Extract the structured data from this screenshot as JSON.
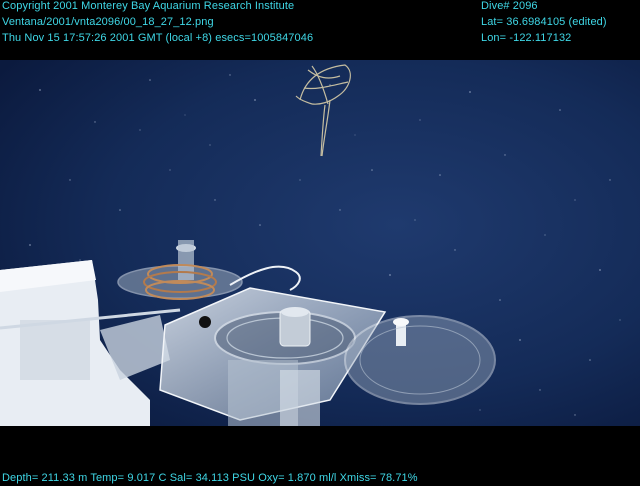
{
  "header": {
    "left_lines": [
      "Copyright 2001 Monterey Bay Aquarium Research Institute",
      "Ventana/2001/vnta2096/00_18_27_12.png",
      "Thu Nov 15 17:57:26 2001 GMT (local +8)  esecs=1005847046"
    ],
    "right_lines": [
      "Dive# 2096",
      "Lat= 36.6984105 (edited)",
      "Lon= -122.117132"
    ]
  },
  "footer": {
    "telemetry": "Depth= 211.33 m  Temp= 9.017 C  Sal= 34.113 PSU  Oxy= 1.870 ml/l  Xmiss= 78.71%"
  },
  "colors": {
    "overlay_text": "#3fd7e6",
    "water_deep": "#0b1a3e",
    "water_light": "#1f3a6e"
  }
}
